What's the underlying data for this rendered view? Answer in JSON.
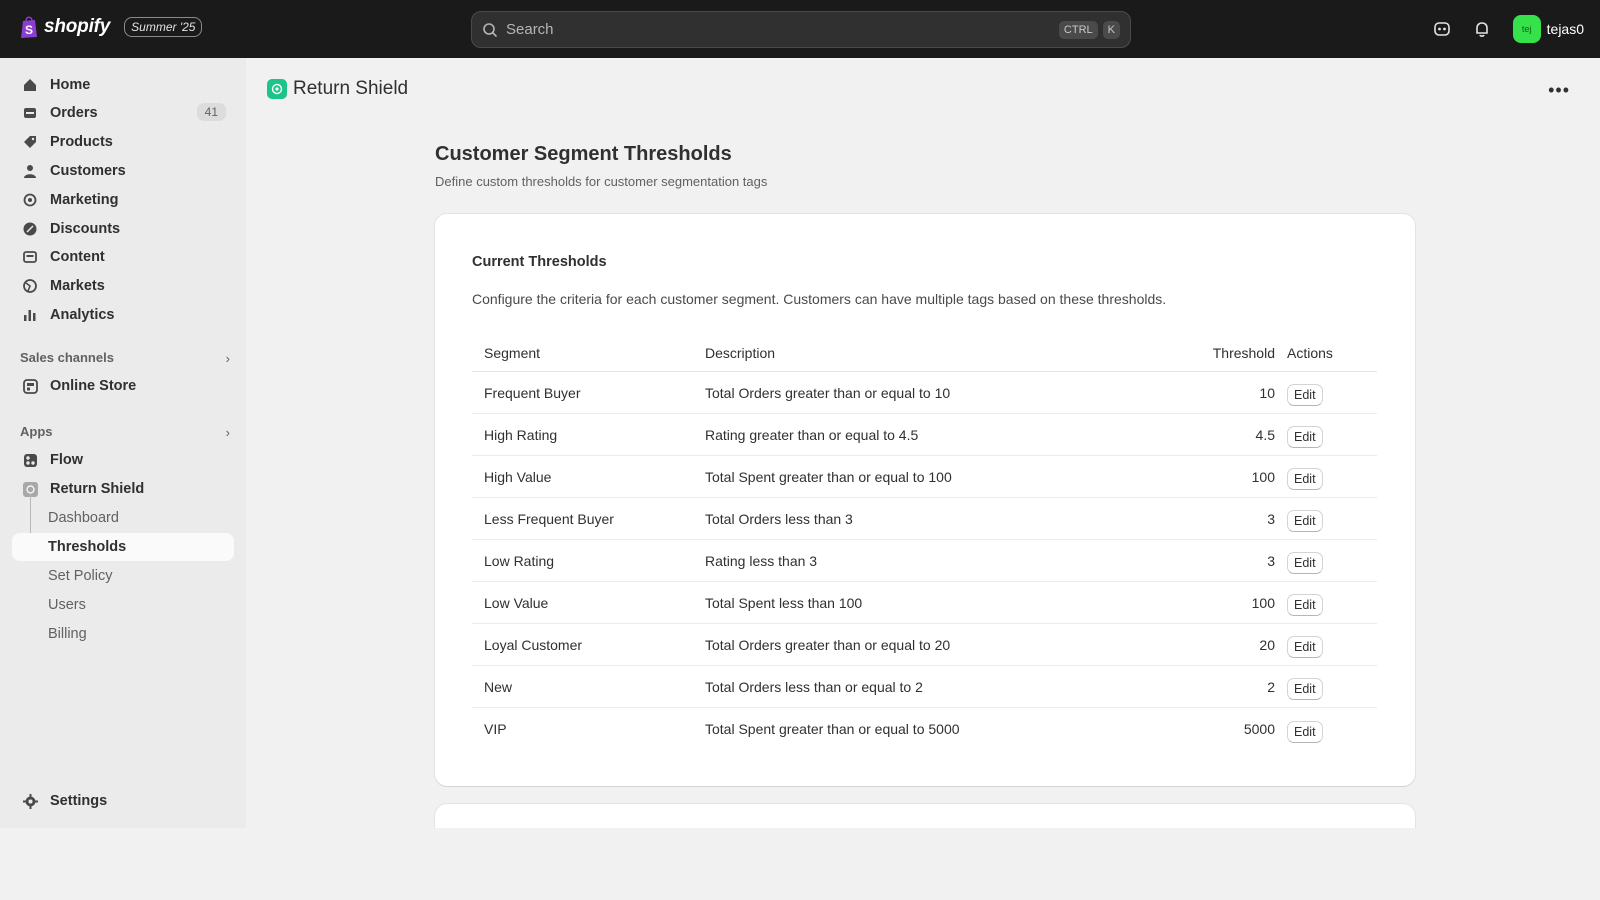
{
  "topbar": {
    "brand": "shopify",
    "edition": "Summer '25",
    "search_placeholder": "Search",
    "shortcut_key1": "CTRL",
    "shortcut_key2": "K",
    "avatar_initials": "tej",
    "username": "tejas0"
  },
  "sidebar": {
    "items": [
      {
        "label": "Home",
        "icon": "home-icon"
      },
      {
        "label": "Orders",
        "icon": "orders-icon",
        "badge": "41"
      },
      {
        "label": "Products",
        "icon": "tag-icon"
      },
      {
        "label": "Customers",
        "icon": "person-icon"
      },
      {
        "label": "Marketing",
        "icon": "target-icon"
      },
      {
        "label": "Discounts",
        "icon": "discount-icon"
      },
      {
        "label": "Content",
        "icon": "content-icon"
      },
      {
        "label": "Markets",
        "icon": "globe-icon"
      },
      {
        "label": "Analytics",
        "icon": "bar-chart-icon"
      }
    ],
    "sales_channels_label": "Sales channels",
    "online_store_label": "Online Store",
    "apps_label": "Apps",
    "flow_label": "Flow",
    "return_shield_label": "Return Shield",
    "sub_items": [
      "Dashboard",
      "Thresholds",
      "Set Policy",
      "Users",
      "Billing"
    ],
    "active_sub_item": "Thresholds",
    "settings_label": "Settings"
  },
  "page_header": {
    "app_name": "Return Shield"
  },
  "content": {
    "title": "Customer Segment Thresholds",
    "subtitle": "Define custom thresholds for customer segmentation tags"
  },
  "card": {
    "title": "Current Thresholds",
    "description": "Configure the criteria for each customer segment. Customers can have multiple tags based on these thresholds."
  },
  "table": {
    "headers": [
      "Segment",
      "Description",
      "Threshold",
      "Actions"
    ],
    "edit_label": "Edit",
    "rows": [
      {
        "segment": "Frequent Buyer",
        "description": "Total Orders greater than or equal to 10",
        "threshold": "10"
      },
      {
        "segment": "High Rating",
        "description": "Rating greater than or equal to 4.5",
        "threshold": "4.5"
      },
      {
        "segment": "High Value",
        "description": "Total Spent greater than or equal to 100",
        "threshold": "100"
      },
      {
        "segment": "Less Frequent Buyer",
        "description": "Total Orders less than 3",
        "threshold": "3"
      },
      {
        "segment": "Low Rating",
        "description": "Rating less than 3",
        "threshold": "3"
      },
      {
        "segment": "Low Value",
        "description": "Total Spent less than 100",
        "threshold": "100"
      },
      {
        "segment": "Loyal Customer",
        "description": "Total Orders greater than or equal to 20",
        "threshold": "20"
      },
      {
        "segment": "New",
        "description": "Total Orders less than or equal to 2",
        "threshold": "2"
      },
      {
        "segment": "VIP",
        "description": "Total Spent greater than or equal to 5000",
        "threshold": "5000"
      }
    ]
  },
  "colors": {
    "topbar_bg": "#1a1a1a",
    "app_icon": "#1cc48a",
    "avatar": "#36e24a",
    "brand_bag": "#95bf47"
  }
}
